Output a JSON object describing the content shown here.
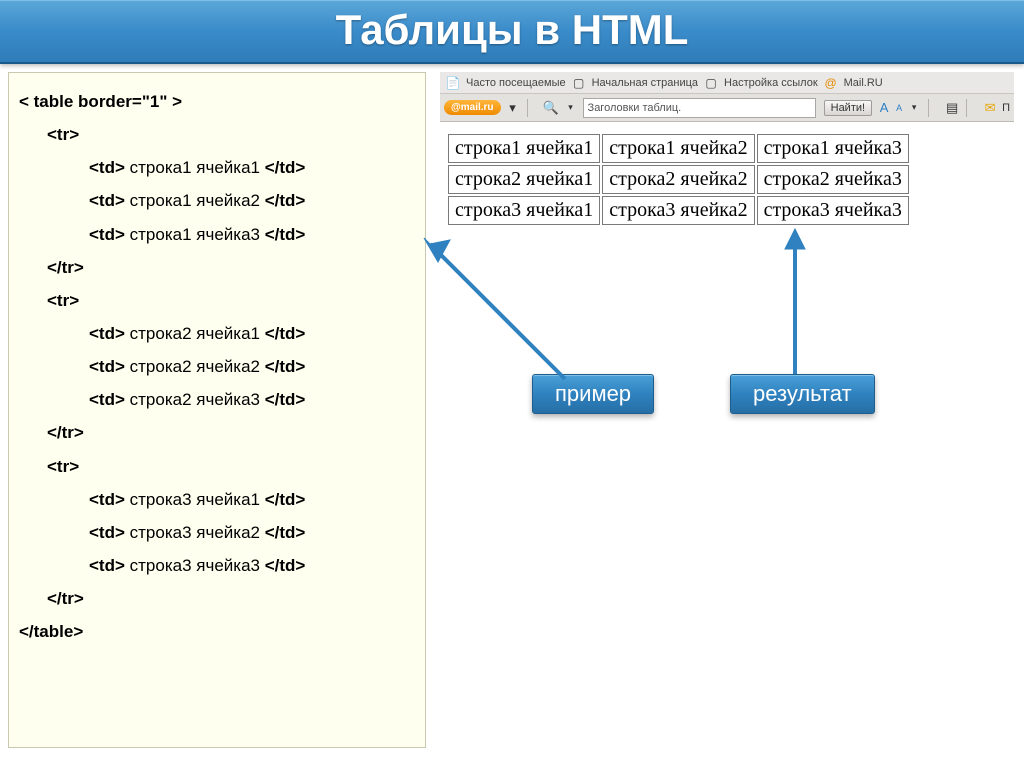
{
  "title": "Таблицы в HTML",
  "code": {
    "l0": "< table border=\"1\" >",
    "tr_open": "<tr>",
    "tr_close": "</tr>",
    "table_close": "</table>",
    "row1": {
      "c1": " строка1 ячейка1 ",
      "c2": " строка1 ячейка2 ",
      "c3": " строка1 ячейка3 "
    },
    "row2": {
      "c1": " строка2 ячейка1 ",
      "c2": " строка2 ячейка2 ",
      "c3": " строка2 ячейка3 "
    },
    "row3": {
      "c1": " строка3 ячейка1 ",
      "c2": " строка3 ячейка2 ",
      "c3": " строка3 ячейка3 "
    },
    "td_o": "<td>",
    "td_c": "</td>"
  },
  "bookmarks": {
    "freq": "Часто посещаемые",
    "home": "Начальная страница",
    "links": "Настройка ссылок",
    "mail": "Mail.RU"
  },
  "toolbar": {
    "mail_brand": "@mail.ru",
    "search_text": "Заголовки таблиц.",
    "find": "Найти!",
    "last_label": "П"
  },
  "rendered": {
    "r1": {
      "c1": "строка1 ячейка1",
      "c2": "строка1 ячейка2",
      "c3": "строка1 ячейка3"
    },
    "r2": {
      "c1": "строка2 ячейка1",
      "c2": "строка2 ячейка2",
      "c3": "строка2 ячейка3"
    },
    "r3": {
      "c1": "строка3 ячейка1",
      "c2": "строка3 ячейка2",
      "c3": "строка3 ячейка3"
    }
  },
  "callouts": {
    "example": "пример",
    "result": "результат"
  }
}
